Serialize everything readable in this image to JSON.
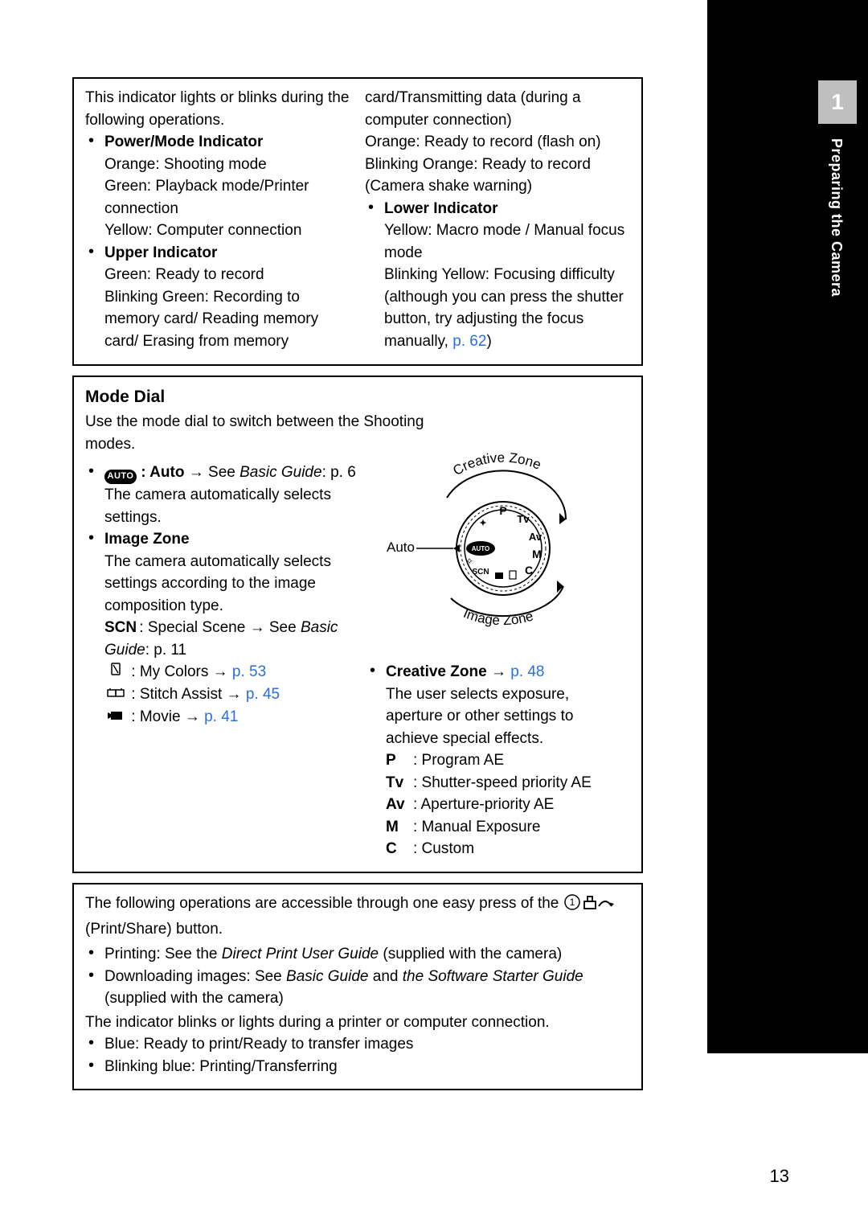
{
  "chapter": {
    "num": "1",
    "label": "Preparing the Camera"
  },
  "indicators": {
    "intro": "This indicator lights or blinks during the following operations.",
    "power": {
      "title": "Power/Mode Indicator",
      "l1": "Orange: Shooting mode",
      "l2": "Green: Playback mode/Printer connection",
      "l3": "Yellow: Computer connection"
    },
    "upper": {
      "title": "Upper Indicator",
      "l1": "Green: Ready to record",
      "l2": "Blinking Green: Recording to memory card/ Reading memory card/ Erasing from memory card/Transmitting data (during a computer connection)",
      "l3": "Orange: Ready to record (flash on)",
      "l4": "Blinking Orange: Ready to record (Camera shake warning)"
    },
    "lower": {
      "title": "Lower Indicator",
      "l1": "Yellow: Macro mode / Manual focus mode",
      "l2_a": "Blinking Yellow: Focusing difficulty (although you can press the shutter button, try adjusting the focus manually, ",
      "l2_link": "p. 62",
      "l2_b": ")"
    }
  },
  "modeDial": {
    "heading": "Mode Dial",
    "intro": "Use the mode dial to switch between the Shooting modes.",
    "auto": {
      "label": ": Auto",
      "see": " See ",
      "basic": "Basic Guide",
      "page": ": p. 6",
      "desc": "The camera automatically selects settings."
    },
    "imageZone": {
      "title": "Image Zone",
      "desc": "The camera automatically selects settings according to the image composition type.",
      "scn": {
        "sym": "SCN",
        "text": " : Special Scene ",
        "see": " See ",
        "basic": "Basic Guide",
        "page": ": p. 11"
      },
      "mycolors": {
        "text": ": My Colors ",
        "link": "p. 53"
      },
      "stitch": {
        "text": ": Stitch Assist ",
        "link": "p. 45"
      },
      "movie": {
        "text": ": Movie ",
        "link": "p. 41"
      }
    },
    "creativeZone": {
      "title": "Creative Zone",
      "titleLink": "p. 48",
      "desc": "The user selects exposure, aperture or other settings to achieve special effects.",
      "p": {
        "sym": "P",
        "desc": ": Program AE"
      },
      "tv": {
        "sym": "Tv",
        "desc": ": Shutter-speed priority AE"
      },
      "av": {
        "sym": "Av",
        "desc": ": Aperture-priority AE"
      },
      "m": {
        "sym": "M",
        "desc": ": Manual Exposure"
      },
      "c": {
        "sym": "C",
        "desc": ": Custom"
      }
    },
    "diagram": {
      "creative": "Creative Zone",
      "image": "Image Zone",
      "auto": "Auto",
      "autoTag": "AUTO"
    }
  },
  "printShare": {
    "intro_a": "The following operations are accessible through one easy press of the ",
    "intro_b": " (Print/Share) button.",
    "printing_a": "Printing: See the ",
    "printing_i": "Direct Print User Guide",
    "printing_b": " (supplied with the camera)",
    "download_a": "Downloading images: See ",
    "download_i1": "Basic Guide",
    "download_mid": " and ",
    "download_i2": "the Software Starter Guide",
    "download_b": " (supplied with the camera)",
    "ind_intro": "The indicator blinks or lights during a printer or computer connection.",
    "blue": "Blue: Ready to print/Ready to transfer images",
    "blink": "Blinking blue: Printing/Transferring"
  },
  "pageNumber": "13"
}
